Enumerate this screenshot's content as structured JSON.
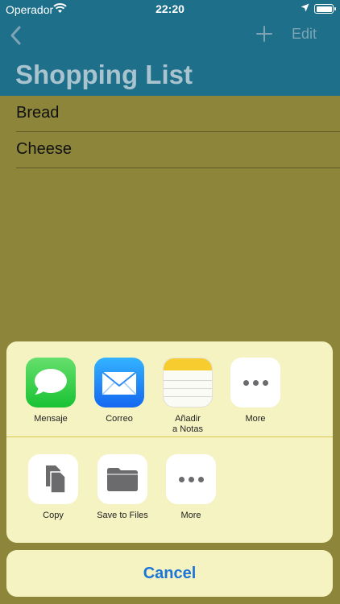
{
  "status_bar": {
    "carrier": "Operador",
    "time": "22:20"
  },
  "navbar": {
    "edit_label": "Edit",
    "title": "Shopping List"
  },
  "list": {
    "items": [
      "Bread",
      "Cheese"
    ]
  },
  "share_sheet": {
    "apps": [
      {
        "label": "Mensaje",
        "icon": "messages-icon"
      },
      {
        "label": "Correo",
        "icon": "mail-icon"
      },
      {
        "label": "Añadir\na Notas",
        "icon": "notes-icon"
      },
      {
        "label": "More",
        "icon": "more-icon"
      }
    ],
    "actions": [
      {
        "label": "Copy",
        "icon": "copy-icon"
      },
      {
        "label": "Save to Files",
        "icon": "folder-icon"
      },
      {
        "label": "More",
        "icon": "more-icon"
      }
    ],
    "cancel_label": "Cancel"
  },
  "colors": {
    "accent": "#1b74d8",
    "nav_bg": "#1e6f8a",
    "sheet_bg": "#f5f3c2"
  }
}
